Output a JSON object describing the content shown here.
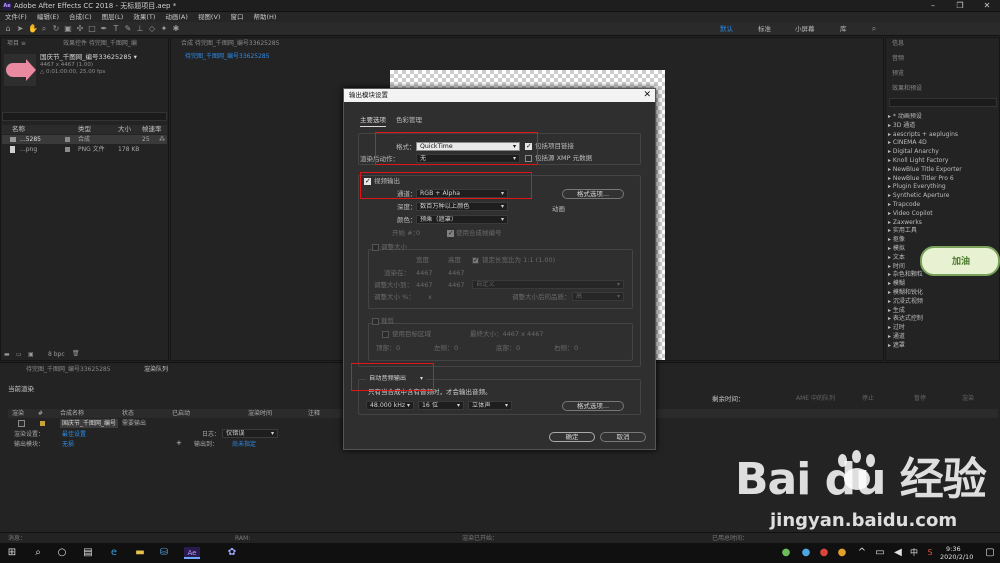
{
  "window": {
    "title": "Adobe After Effects CC 2018 - 无标题项目.aep *",
    "app_badge": "Ae",
    "controls": [
      "–",
      "❐",
      "✕"
    ]
  },
  "menu": [
    "文件(F)",
    "编辑(E)",
    "合成(C)",
    "图层(L)",
    "效果(T)",
    "动画(A)",
    "视图(V)",
    "窗口",
    "帮助(H)"
  ],
  "workspaces": [
    "默认",
    "标准",
    "小屏幕",
    "库"
  ],
  "project": {
    "tab": "项目 ≡",
    "tab2": "效果控件 待完图_千图网_编",
    "item_name": "国庆节_千图网_编号33625285 ▾",
    "item_size": "4467 x 4467 (1.00)",
    "item_duration": "△ 0:01:00:00, 25.00 fps",
    "columns": [
      "名称",
      "类型",
      "大小",
      "帧速率"
    ],
    "rows": [
      {
        "name": "...5285",
        "type": "合成",
        "size": "",
        "fps": "25"
      },
      {
        "name": "...png",
        "type": "PNG 文件",
        "size": "178 KB",
        "fps": ""
      }
    ],
    "bpc": "8 bpc"
  },
  "composition": {
    "tab": "合成 待完图_千图网_编号33625285",
    "subtab": "待完图_千图网_编号33625285"
  },
  "dialog": {
    "title": "输出模块设置",
    "close": "✕",
    "tabs": [
      "主要选项",
      "色彩管理"
    ],
    "format_label": "格式：",
    "format_value": "QuickTime",
    "include_project_link": "包括项目链接",
    "post_render_label": "渲染后动作：",
    "post_render_value": "无",
    "include_xmp": "包括源 XMP 元数据",
    "video_output": "视频输出",
    "channels_label": "通道：",
    "channels_value": "RGB + Alpha",
    "format_options": "格式选项...",
    "depth_label": "深度：",
    "depth_value": "数百万种以上颜色",
    "animation": "动画",
    "color_label": "颜色：",
    "color_value": "预乘（遮罩）",
    "start_label": "开始 #：",
    "start_value": "0",
    "use_comp_frame": "使用合成帧编号",
    "resize": "调整大小",
    "width_label": "宽度",
    "height_label": "高度",
    "lock_aspect": "锁定长宽比为 1:1 (1.00)",
    "render_at_label": "渲染在：",
    "render_at_w": "4467",
    "render_at_h": "4467",
    "resize_to_label": "调整大小到：",
    "resize_to_w": "4467",
    "resize_to_h": "4467",
    "custom": "自定义",
    "resize_pct_label": "调整大小 %：",
    "resize_pct_x": "x",
    "resize_quality_label": "调整大小后的品质：",
    "resize_quality_value": "高",
    "crop": "裁剪",
    "use_roi": "使用目标区域",
    "final_size": "最终大小：4467 x 4467",
    "top_label": "顶部：",
    "top_value": "0",
    "left_label": "左侧：",
    "left_value": "0",
    "bottom_label": "底部：",
    "bottom_value": "0",
    "right_label": "右侧：",
    "right_value": "0",
    "audio_auto": "自动音频输出",
    "audio_note": "只有当合成中含有音频时，才会输出音频。",
    "sample_rate": "48.000 kHz",
    "bit_depth": "16 位",
    "stereo": "立体声",
    "audio_format_options": "格式选项...",
    "ok": "确定",
    "cancel": "取消"
  },
  "effects": {
    "tab1": "信息",
    "tab2": "音频",
    "tab3": "预览",
    "tab4": "效果和预设",
    "items": [
      "▸ * 动画预设",
      "▸ 3D 通道",
      "▸ aescripts + aeplugins",
      "▸ CINEMA 4D",
      "▸ Digital Anarchy",
      "▸ Knoll Light Factory",
      "▸ NewBlue Title Exporter",
      "▸ NewBlue Titler Pro 6",
      "▸ Plugin Everything",
      "▸ Synthetic Aperture",
      "▸ Trapcode",
      "▸ Video Copilot",
      "▸ Zaxwerks",
      "▸ 实用工具",
      "▸ 抠像",
      "▸ 模拟",
      "▸ 文本",
      "▸ 时间",
      "▸ 杂色和颗粒",
      "▸ 模糊",
      "▸ 模糊和锐化",
      "▸ 沉浸式视频",
      "▸ 生成",
      "▸ 表达式控制",
      "▸ 过时",
      "▸ 通道",
      "▸ 遮罩"
    ]
  },
  "timeline": {
    "tab1": "待完图_千图网_编号33625285",
    "tab2": "渲染队列",
    "current_render": "当前渲染",
    "remaining": "剩余时间：",
    "buttons": [
      "AME 中的队列",
      "停止",
      "暂停",
      "渲染"
    ],
    "headers": [
      "渲染",
      "#",
      "合成名称",
      "状态",
      "已启动",
      "渲染时间",
      "注释"
    ],
    "row_comp": "国庆节_千图网_编号",
    "row_status": "需要输出",
    "render_settings_label": "渲染设置：",
    "render_settings_value": "最佳设置",
    "log_label": "日志：",
    "log_value": "仅错误",
    "output_module_label": "输出模块：",
    "output_module_value": "无损",
    "output_to_label": "输出到：",
    "output_to_value": "尚未指定",
    "status_msg": "消息：",
    "status_ram": "RAM:",
    "status_started": "渲染已开始：",
    "status_total": "已用总时间："
  },
  "taskbar": {
    "time": "9:36",
    "date": "2020/2/10",
    "ime": "中"
  },
  "watermark": {
    "brand": "Bai du 经验",
    "url": "jingyan.baidu.com"
  },
  "sticker": {
    "text": "加油"
  }
}
